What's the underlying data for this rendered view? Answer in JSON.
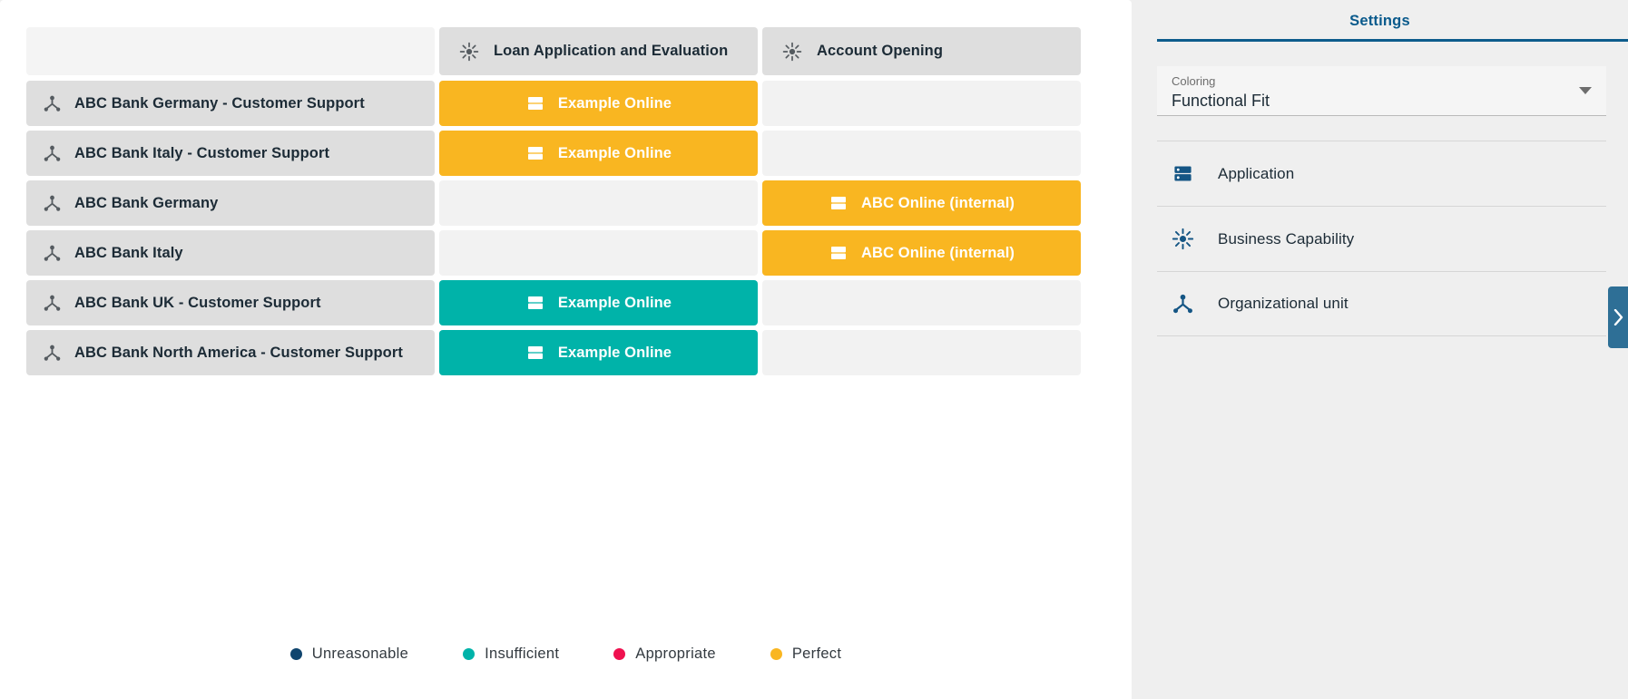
{
  "matrix": {
    "corner_label": "",
    "columns": [
      {
        "label": "Loan Application and Evaluation",
        "icon": "business-capability-icon"
      },
      {
        "label": "Account Opening",
        "icon": "business-capability-icon"
      }
    ],
    "rows": [
      {
        "label": "ABC Bank Germany - Customer Support",
        "icon": "organizational-unit-icon",
        "cells": [
          {
            "label": "Example Online",
            "icon": "application-icon",
            "color": "#f9b621",
            "state": "Perfect"
          },
          {
            "label": "",
            "icon": "",
            "color": "#f2f2f2",
            "state": ""
          }
        ]
      },
      {
        "label": "ABC Bank Italy - Customer Support",
        "icon": "organizational-unit-icon",
        "cells": [
          {
            "label": "Example Online",
            "icon": "application-icon",
            "color": "#f9b621",
            "state": "Perfect"
          },
          {
            "label": "",
            "icon": "",
            "color": "#f2f2f2",
            "state": ""
          }
        ]
      },
      {
        "label": "ABC Bank Germany",
        "icon": "organizational-unit-icon",
        "cells": [
          {
            "label": "",
            "icon": "",
            "color": "#f2f2f2",
            "state": ""
          },
          {
            "label": "ABC Online (internal)",
            "icon": "application-icon",
            "color": "#f9b621",
            "state": "Perfect"
          }
        ]
      },
      {
        "label": "ABC Bank Italy",
        "icon": "organizational-unit-icon",
        "cells": [
          {
            "label": "",
            "icon": "",
            "color": "#f2f2f2",
            "state": ""
          },
          {
            "label": "ABC Online (internal)",
            "icon": "application-icon",
            "color": "#f9b621",
            "state": "Perfect"
          }
        ]
      },
      {
        "label": "ABC Bank UK - Customer Support",
        "icon": "organizational-unit-icon",
        "cells": [
          {
            "label": "Example Online",
            "icon": "application-icon",
            "color": "#00b3a9",
            "state": "Insufficient"
          },
          {
            "label": "",
            "icon": "",
            "color": "#f2f2f2",
            "state": ""
          }
        ]
      },
      {
        "label": "ABC Bank North America - Customer Support",
        "icon": "organizational-unit-icon",
        "cells": [
          {
            "label": "Example Online",
            "icon": "application-icon",
            "color": "#00b3a9",
            "state": "Insufficient"
          },
          {
            "label": "",
            "icon": "",
            "color": "#f2f2f2",
            "state": ""
          }
        ]
      }
    ]
  },
  "legend": {
    "items": [
      {
        "label": "Unreasonable",
        "color": "#10456e"
      },
      {
        "label": "Insufficient",
        "color": "#00b3a9"
      },
      {
        "label": "Appropriate",
        "color": "#ef114f"
      },
      {
        "label": "Perfect",
        "color": "#f9b621"
      }
    ]
  },
  "sidebar": {
    "tab": {
      "label": "Settings"
    },
    "coloring": {
      "label": "Coloring",
      "value": "Functional Fit",
      "caret_icon": "chevron-down-icon"
    },
    "entities": [
      {
        "label": "Application",
        "icon": "application-icon"
      },
      {
        "label": "Business Capability",
        "icon": "business-capability-icon"
      },
      {
        "label": "Organizational unit",
        "icon": "organizational-unit-icon"
      }
    ],
    "collapse": {
      "icon": "chevron-right-icon"
    }
  },
  "colors": {
    "accent_blue": "#0d5c8c",
    "panel_bg": "#ffffff",
    "sidebar_bg": "#efefef",
    "header_cell": "#dedede",
    "empty_cell": "#f2f2f2"
  }
}
